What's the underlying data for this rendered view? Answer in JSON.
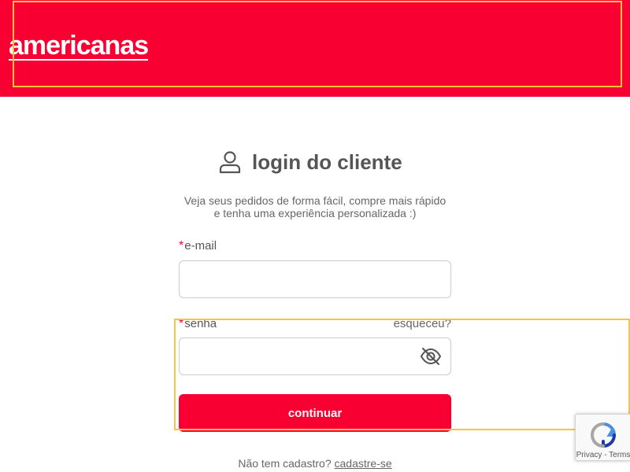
{
  "brand": {
    "logo_text": "americanas",
    "primary_color": "#f80032"
  },
  "login": {
    "title": "login do cliente",
    "subtitle_line1": "Veja seus pedidos de forma fácil, compre mais rápido",
    "subtitle_line2": "e tenha uma experiência personalizada :)",
    "required_marker": "*",
    "email_label": "e-mail",
    "email_value": "",
    "password_label": "senha",
    "password_value": "",
    "forgot_link": "esqueceu?",
    "submit_label": "continuar",
    "no_account_text": "Não tem cadastro?",
    "signup_link": "cadastre-se"
  },
  "recaptcha": {
    "footer_text": "Privacy - Terms"
  },
  "icons": {
    "user": "user-icon",
    "password_visibility": "eye-off-icon",
    "recaptcha": "recaptcha-icon"
  }
}
